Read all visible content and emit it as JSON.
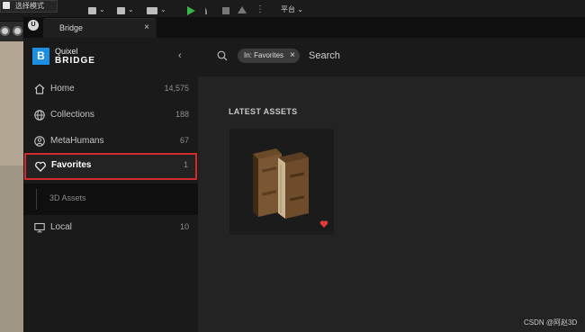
{
  "editor": {
    "mode_label": "选择模式",
    "platform_label": "平台"
  },
  "tab": {
    "title": "Bridge",
    "close": "×"
  },
  "brand": {
    "top": "Quixel",
    "bottom": "BRIDGE",
    "logo_letter": "B"
  },
  "sidebar": {
    "collapse": "‹",
    "items": [
      {
        "label": "Home",
        "count": "14,575",
        "icon": "home-icon"
      },
      {
        "label": "Collections",
        "count": "188",
        "icon": "globe-icon"
      },
      {
        "label": "MetaHumans",
        "count": "67",
        "icon": "person-icon"
      },
      {
        "label": "Favorites",
        "count": "1",
        "icon": "heart-icon"
      },
      {
        "label": "Local",
        "count": "10",
        "icon": "monitor-icon"
      }
    ],
    "sub_item": "3D Assets"
  },
  "search": {
    "chip_label": "In: Favorites",
    "chip_close": "×",
    "placeholder": "Search"
  },
  "main": {
    "section_title": "LATEST ASSETS"
  },
  "watermark": "CSDN @阿赵3D",
  "colors": {
    "accent": "#1d8fe0",
    "highlight_border": "#d32b2b",
    "favorite_heart": "#e13b3b"
  }
}
